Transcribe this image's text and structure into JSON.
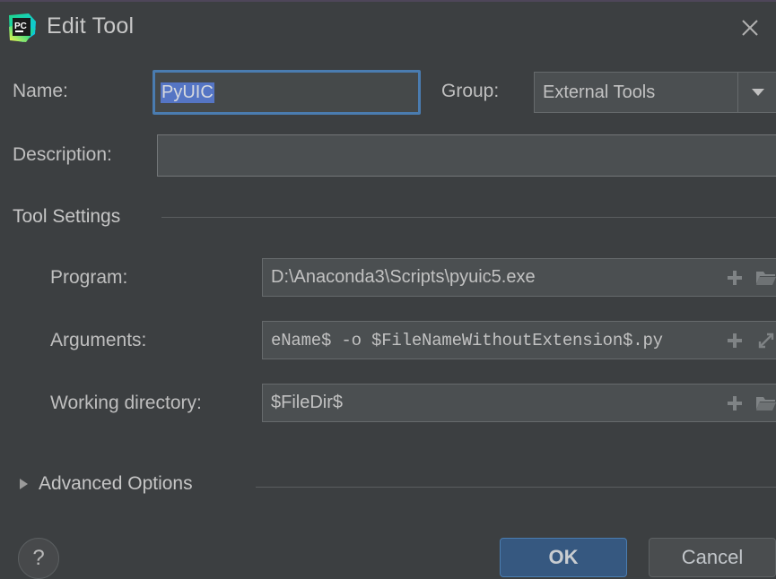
{
  "window": {
    "title": "Edit Tool",
    "app_icon": "pycharm-logo-icon",
    "close_icon": "close-icon"
  },
  "form": {
    "name": {
      "label": "Name:",
      "value": "PyUIC",
      "selected": true
    },
    "group": {
      "label": "Group:",
      "value": "External Tools",
      "dropdown_icon": "chevron-down-icon"
    },
    "description": {
      "label": "Description:",
      "value": "",
      "placeholder": ""
    }
  },
  "tool_settings": {
    "section_label": "Tool Settings",
    "rows": [
      {
        "label": "Program:",
        "value": "D:\\Anaconda3\\Scripts\\pyuic5.exe",
        "monospace": false,
        "icons": [
          "plus-icon",
          "folder-icon"
        ]
      },
      {
        "label": "Arguments:",
        "value": "eName$ -o $FileNameWithoutExtension$.py",
        "monospace": true,
        "icons": [
          "plus-icon",
          "expand-icon"
        ]
      },
      {
        "label": "Working directory:",
        "value": "$FileDir$",
        "monospace": false,
        "icons": [
          "plus-icon",
          "folder-icon"
        ]
      }
    ]
  },
  "advanced": {
    "label": "Advanced Options",
    "expanded": false,
    "toggle_icon": "triangle-right-icon"
  },
  "footer": {
    "help_label": "?",
    "ok_label": "OK",
    "cancel_label": "Cancel"
  },
  "colors": {
    "dialog_bg": "#3c3f41",
    "field_bg": "#4b4f51",
    "accent_blue": "#4a7cb0",
    "ok_button": "#365880",
    "selection": "#5575c4",
    "text": "#bfbfbf"
  }
}
